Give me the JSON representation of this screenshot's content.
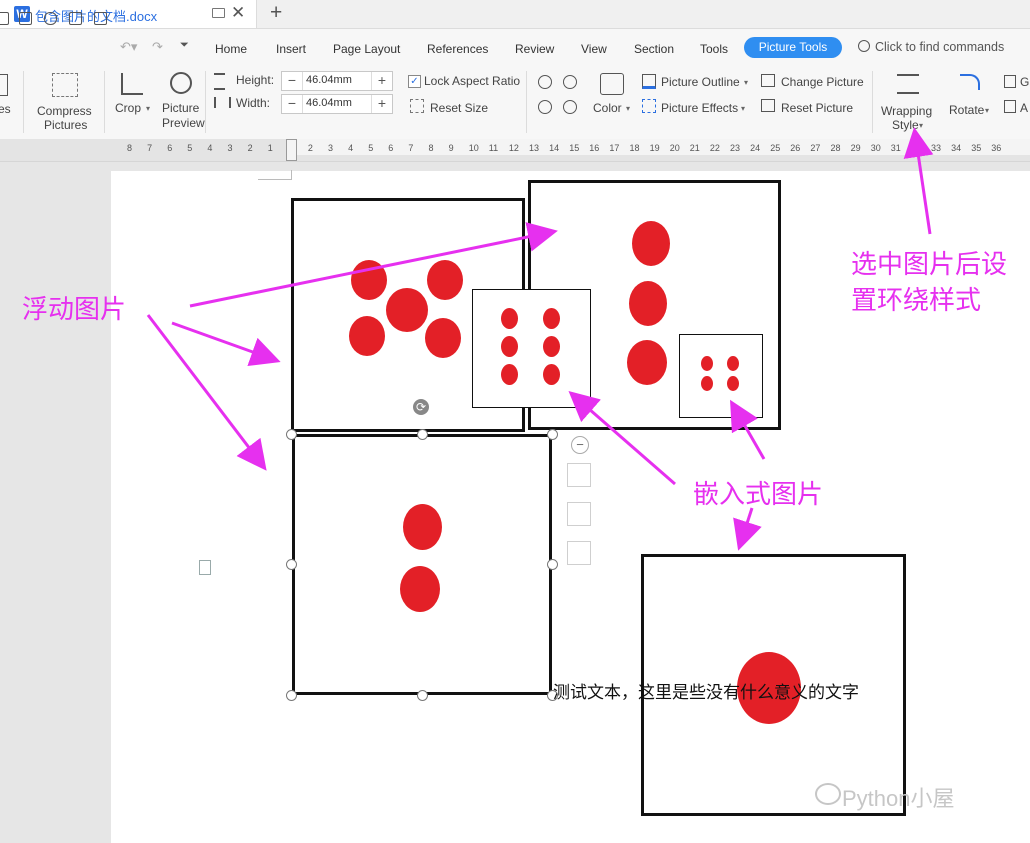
{
  "titlebar": {
    "doc_name": "包含图片的文档.docx",
    "logo_letter": "W",
    "close_glyph": "✕",
    "new_tab_glyph": "+"
  },
  "menu": {
    "items": [
      "Home",
      "Insert",
      "Page Layout",
      "References",
      "Review",
      "View",
      "Section",
      "Tools"
    ],
    "active": "Picture Tools",
    "search_placeholder": "Click to find commands"
  },
  "ribbon": {
    "left_cut_label": "es",
    "compress": [
      "Compress",
      "Pictures"
    ],
    "crop": "Crop",
    "preview": [
      "Picture",
      "Preview"
    ],
    "height_label": "Height:",
    "height_value": "46.04mm",
    "width_label": "Width:",
    "width_value": "46.04mm",
    "lock_aspect": "Lock Aspect Ratio",
    "lock_aspect_checked": true,
    "reset_size": "Reset Size",
    "color": "Color",
    "picture_outline": "Picture Outline",
    "picture_effects": "Picture Effects",
    "change_picture": "Change Picture",
    "reset_picture": "Reset Picture",
    "wrapping": [
      "Wrapping",
      "Style"
    ],
    "rotate": "Rotate",
    "cut_right_1": "G",
    "cut_right_2": "A"
  },
  "ruler": {
    "ticks": [
      "8",
      "7",
      "6",
      "5",
      "4",
      "3",
      "2",
      "1",
      "1",
      "2",
      "3",
      "4",
      "5",
      "6",
      "7",
      "8",
      "9",
      "10",
      "11",
      "12",
      "13",
      "14",
      "15",
      "16",
      "17",
      "18",
      "19",
      "20",
      "21",
      "22",
      "23",
      "24",
      "25",
      "26",
      "27",
      "28",
      "29",
      "30",
      "31",
      "32",
      "33",
      "34",
      "35",
      "36"
    ]
  },
  "document": {
    "body_text": "测试文本，这里是些没有什么意义的文字"
  },
  "annotations": {
    "floating": "浮动图片",
    "inline": "嵌入式图片",
    "wrap_hint_line1": "选中图片后设",
    "wrap_hint_line2": "置环绕样式"
  },
  "watermark": "Python小屋",
  "colors": {
    "accent": "#2f8ef1",
    "annotation": "#e630ef",
    "dot": "#e32027"
  }
}
